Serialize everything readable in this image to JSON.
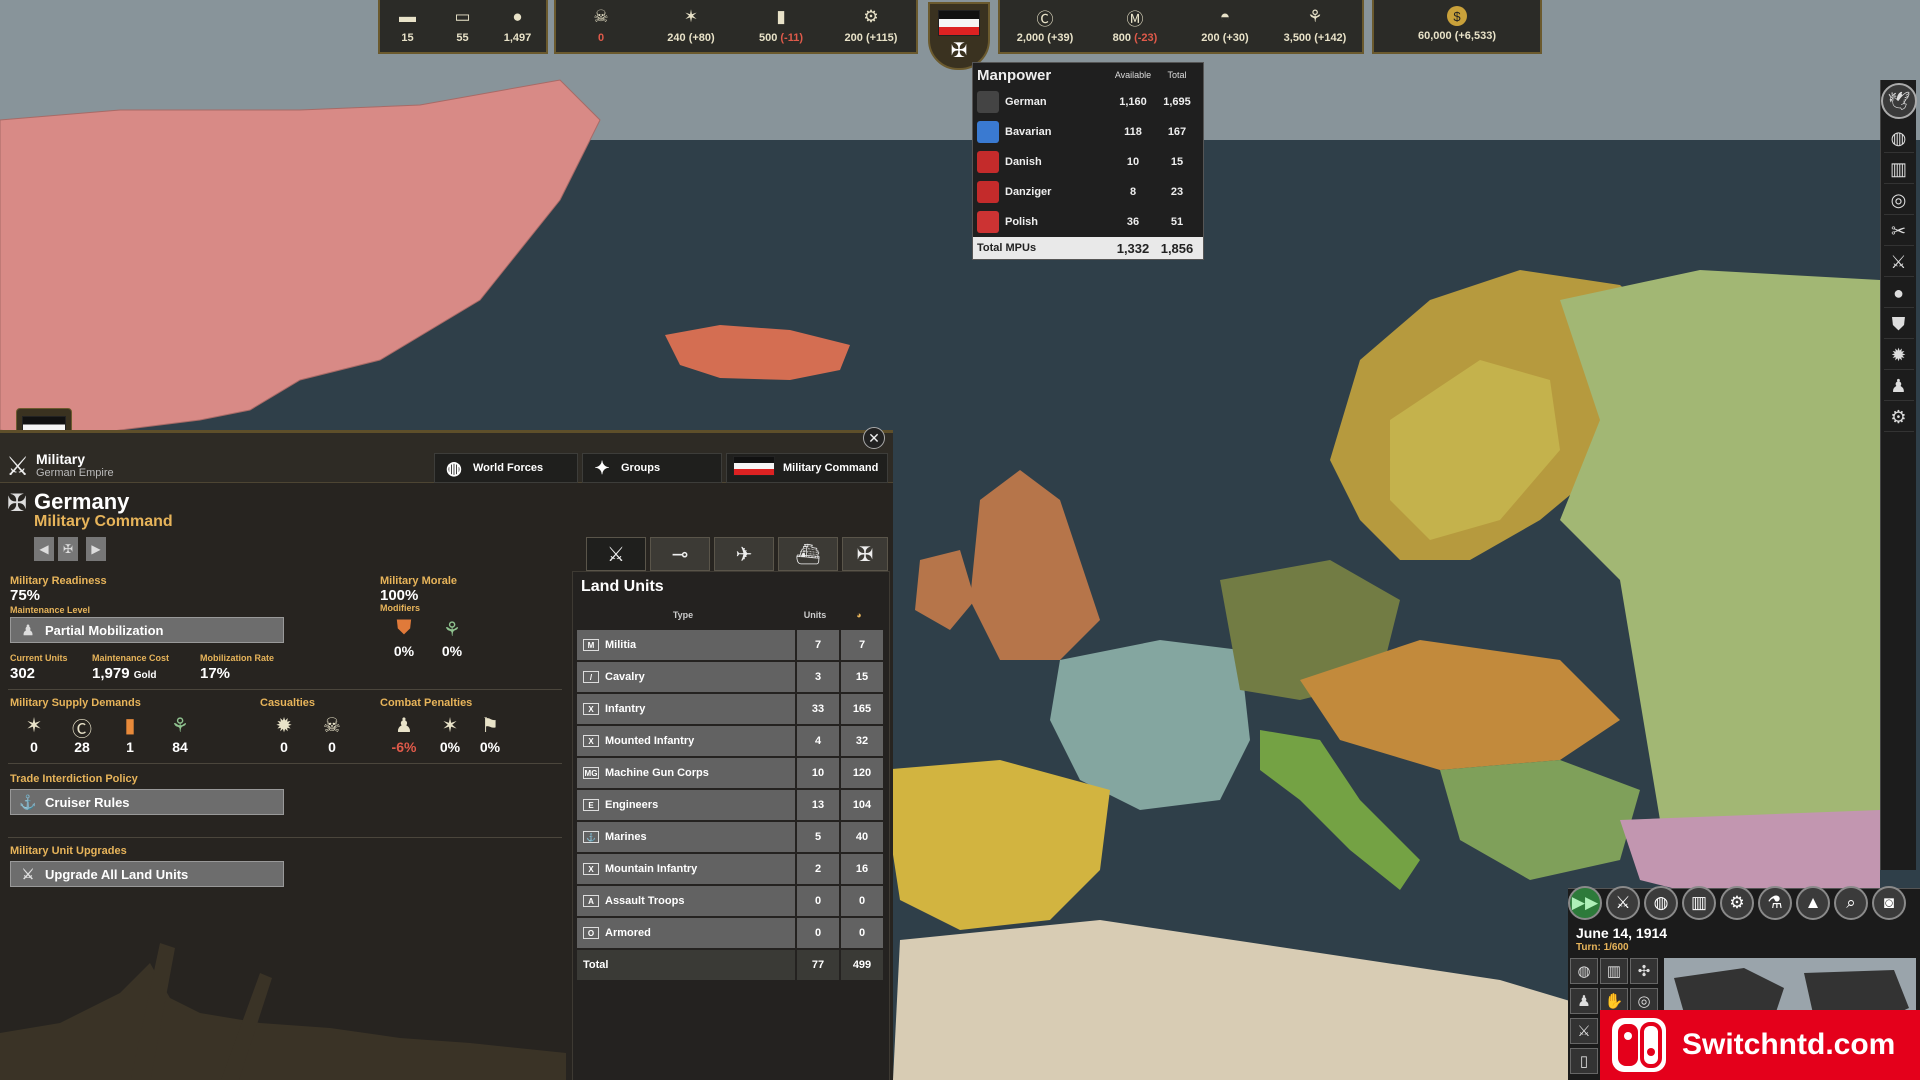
{
  "topbar": {
    "left": [
      {
        "icon": "truck-icon",
        "glyph": "▬",
        "value": "15"
      },
      {
        "icon": "railcar-icon",
        "glyph": "▭",
        "value": "55"
      },
      {
        "icon": "shell-icon",
        "glyph": "●",
        "value": "1,497"
      }
    ],
    "mid": [
      {
        "icon": "mask-icon",
        "glyph": "☠",
        "value": "0",
        "style": "zero"
      },
      {
        "icon": "artillery-icon",
        "glyph": "✶",
        "value": "240",
        "delta": "(+80)"
      },
      {
        "icon": "fuel-icon",
        "glyph": "▮",
        "value": "500",
        "delta": "(-11)",
        "neg": true
      },
      {
        "icon": "gear-icon",
        "glyph": "⚙",
        "value": "200",
        "delta": "(+115)"
      }
    ],
    "right": [
      {
        "icon": "coal-icon",
        "glyph": "Ⓒ",
        "value": "2,000",
        "delta": "(+39)"
      },
      {
        "icon": "metal-icon",
        "glyph": "Ⓜ",
        "value": "800",
        "delta": "(-23)",
        "neg": true
      },
      {
        "icon": "oil-icon",
        "glyph": "◓",
        "value": "200",
        "delta": "(+30)"
      },
      {
        "icon": "grain-icon",
        "glyph": "⚘",
        "value": "3,500",
        "delta": "(+142)"
      }
    ],
    "gold": {
      "icon": "gold-icon",
      "glyph": "$",
      "value": "60,000",
      "delta": "(+6,533)"
    }
  },
  "manpower": {
    "title": "Manpower",
    "col_available": "Available",
    "col_total": "Total",
    "rows": [
      {
        "name": "German",
        "available": "1,160",
        "total": "1,695",
        "color": "#444444"
      },
      {
        "name": "Bavarian",
        "available": "118",
        "total": "167",
        "color": "#3a7ad1"
      },
      {
        "name": "Danish",
        "available": "10",
        "total": "15",
        "color": "#c42b2b"
      },
      {
        "name": "Danziger",
        "available": "8",
        "total": "23",
        "color": "#c42b2b"
      },
      {
        "name": "Polish",
        "available": "36",
        "total": "51",
        "color": "#cc3333"
      }
    ],
    "total_label": "Total MPUs",
    "total_available": "1,332",
    "total_total": "1,856"
  },
  "panel": {
    "header_title": "Military",
    "header_sub": "German Empire",
    "tabs": [
      "World Forces",
      "Groups",
      "Military Command"
    ],
    "country": "Germany",
    "section": "Military Command",
    "readiness_label": "Military Readiness",
    "readiness": "75%",
    "maintenance_label": "Maintenance Level",
    "maintenance_value": "Partial Mobilization",
    "morale_label": "Military Morale",
    "morale": "100%",
    "modifiers_label": "Modifiers",
    "mod1": "0%",
    "mod2": "0%",
    "current_units_label": "Current Units",
    "current_units": "302",
    "maint_cost_label": "Maintenance Cost",
    "maint_cost": "1,979",
    "maint_cost_unit": "Gold",
    "mob_rate_label": "Mobilization Rate",
    "mob_rate": "17%",
    "supply_label": "Military Supply Demands",
    "supply": [
      "0",
      "28",
      "1",
      "84"
    ],
    "casualties_label": "Casualties",
    "casualties": [
      "0",
      "0"
    ],
    "penalties_label": "Combat Penalties",
    "penalties": [
      "-6%",
      "0%",
      "0%"
    ],
    "trade_label": "Trade Interdiction Policy",
    "trade_value": "Cruiser Rules",
    "upgrades_label": "Military Unit Upgrades",
    "upgrades_value": "Upgrade All Land Units"
  },
  "land": {
    "title": "Land Units",
    "col_type": "Type",
    "col_units": "Units",
    "rows": [
      {
        "type": "Militia",
        "units": "7",
        "total": "7",
        "icon": "M"
      },
      {
        "type": "Cavalry",
        "units": "3",
        "total": "15",
        "icon": "/"
      },
      {
        "type": "Infantry",
        "units": "33",
        "total": "165",
        "icon": "X"
      },
      {
        "type": "Mounted Infantry",
        "units": "4",
        "total": "32",
        "icon": "X"
      },
      {
        "type": "Machine Gun Corps",
        "units": "10",
        "total": "120",
        "icon": "MG"
      },
      {
        "type": "Engineers",
        "units": "13",
        "total": "104",
        "icon": "E"
      },
      {
        "type": "Marines",
        "units": "5",
        "total": "40",
        "icon": "⚓"
      },
      {
        "type": "Mountain Infantry",
        "units": "2",
        "total": "16",
        "icon": "X"
      },
      {
        "type": "Assault Troops",
        "units": "0",
        "total": "0",
        "icon": "A"
      },
      {
        "type": "Armored",
        "units": "0",
        "total": "0",
        "icon": "O"
      }
    ],
    "total_label": "Total",
    "total_units": "77",
    "total_total": "499"
  },
  "date": "June 14, 1914",
  "turn": "Turn: 1/600",
  "watermark": "Switchntd.com"
}
